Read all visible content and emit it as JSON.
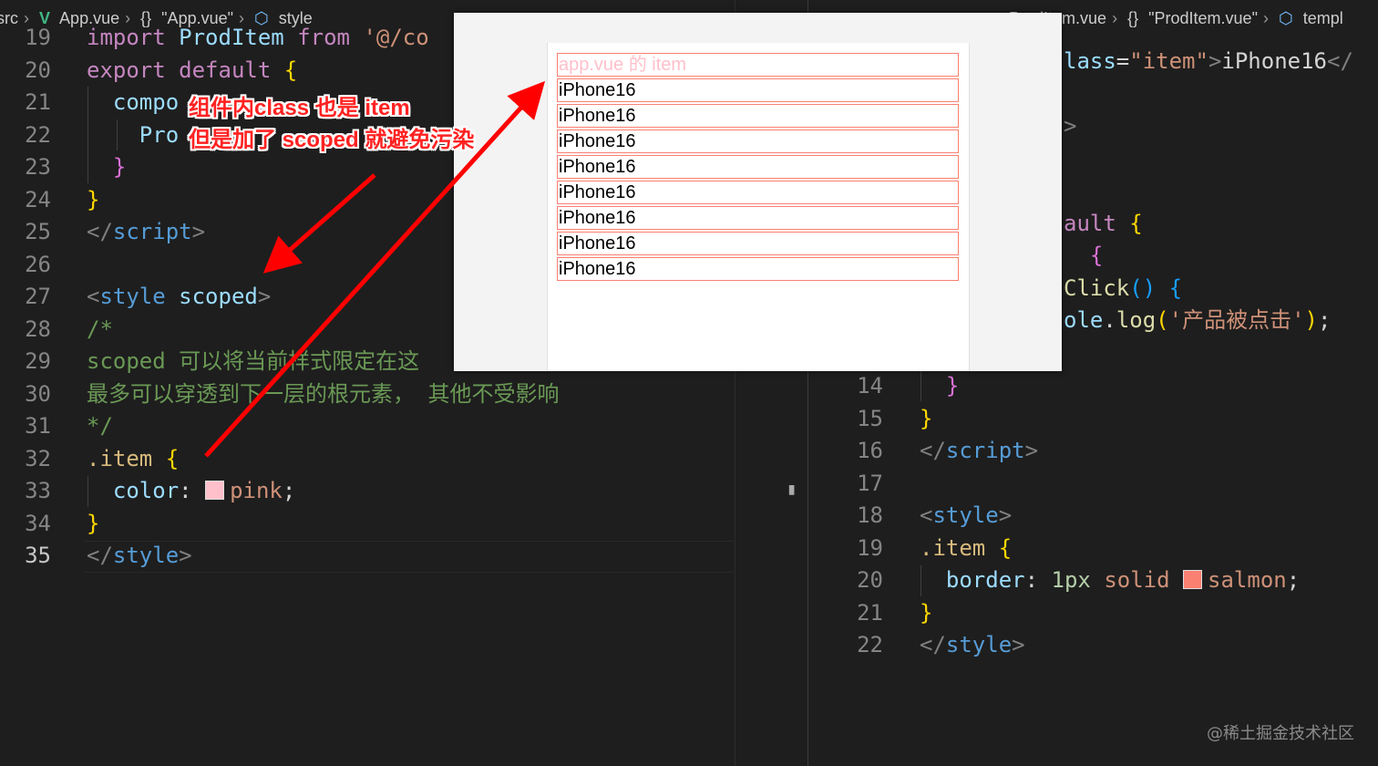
{
  "left_editor": {
    "breadcrumb": {
      "folder": "src",
      "file": "App.vue",
      "component": "\"App.vue\"",
      "section": "style"
    },
    "lines": [
      {
        "n": "19",
        "parts": [
          [
            "t-kw",
            "import"
          ],
          [
            "t-plain",
            " "
          ],
          [
            "t-id",
            "ProdItem"
          ],
          [
            "t-plain",
            " "
          ],
          [
            "t-kw",
            "from"
          ],
          [
            "t-plain",
            " "
          ],
          [
            "t-str",
            "'@/co"
          ]
        ]
      },
      {
        "n": "20",
        "parts": [
          [
            "t-kw",
            "export"
          ],
          [
            "t-plain",
            " "
          ],
          [
            "t-kw",
            "default"
          ],
          [
            "t-plain",
            " "
          ],
          [
            "t-gold",
            "{"
          ]
        ]
      },
      {
        "n": "21",
        "parts": [
          [
            "t-plain",
            "  "
          ],
          [
            "t-id",
            "compo"
          ]
        ]
      },
      {
        "n": "22",
        "parts": [
          [
            "t-plain",
            "    "
          ],
          [
            "t-id",
            "Pro"
          ]
        ]
      },
      {
        "n": "23",
        "parts": [
          [
            "t-plain",
            "  "
          ],
          [
            "t-pur",
            "}"
          ]
        ]
      },
      {
        "n": "24",
        "parts": [
          [
            "t-gold",
            "}"
          ]
        ]
      },
      {
        "n": "25",
        "parts": [
          [
            "t-br",
            "</"
          ],
          [
            "t-tag",
            "script"
          ],
          [
            "t-br",
            ">"
          ]
        ]
      },
      {
        "n": "26",
        "parts": []
      },
      {
        "n": "27",
        "parts": [
          [
            "t-br",
            "<"
          ],
          [
            "t-tag",
            "style"
          ],
          [
            "t-plain",
            " "
          ],
          [
            "t-id",
            "scoped"
          ],
          [
            "t-br",
            ">"
          ]
        ]
      },
      {
        "n": "28",
        "parts": [
          [
            "t-com",
            "/*"
          ]
        ]
      },
      {
        "n": "29",
        "parts": [
          [
            "t-com",
            "scoped 可以将当前样式限定在这"
          ]
        ]
      },
      {
        "n": "30",
        "parts": [
          [
            "t-com",
            "最多可以穿透到下一层的根元素， 其他不受影响"
          ]
        ]
      },
      {
        "n": "31",
        "parts": [
          [
            "t-com",
            "*/"
          ]
        ]
      },
      {
        "n": "32",
        "parts": [
          [
            "t-sel",
            ".item"
          ],
          [
            "t-plain",
            " "
          ],
          [
            "t-gold",
            "{"
          ]
        ]
      },
      {
        "n": "33",
        "parts": [
          [
            "t-plain",
            "  "
          ],
          [
            "t-prop",
            "color"
          ],
          [
            "t-plain",
            ": "
          ],
          [
            "swatch",
            "pink"
          ],
          [
            "t-val",
            "pink"
          ],
          [
            "t-plain",
            ";"
          ]
        ]
      },
      {
        "n": "34",
        "parts": [
          [
            "t-gold",
            "}"
          ]
        ]
      },
      {
        "n": "35",
        "parts": [
          [
            "t-br",
            "</"
          ],
          [
            "t-tag",
            "style"
          ],
          [
            "t-br",
            ">"
          ]
        ]
      }
    ]
  },
  "right_editor": {
    "breadcrumb": {
      "file": "ProdItem.vue",
      "component": "\"ProdItem.vue\"",
      "section": "templ"
    },
    "top_fragments": [
      {
        "parts": [
          [
            "t-id",
            "lass"
          ],
          [
            "t-plain",
            "="
          ],
          [
            "t-str",
            "\"item\""
          ],
          [
            "t-br",
            ">"
          ],
          [
            "t-plain",
            "iPhone16"
          ],
          [
            "t-br",
            "</"
          ]
        ]
      },
      {
        "parts": [
          [
            "t-br",
            ">"
          ]
        ]
      },
      {
        "parts": [
          [
            "t-kw",
            "ault"
          ],
          [
            "t-plain",
            " "
          ],
          [
            "t-gold",
            "{"
          ]
        ]
      },
      {
        "parts": [
          [
            "t-plain",
            "  "
          ],
          [
            "t-pur",
            "{"
          ]
        ]
      },
      {
        "parts": [
          [
            "t-fn",
            "Click"
          ],
          [
            "t-blu",
            "()"
          ],
          [
            "t-plain",
            " "
          ],
          [
            "t-blu",
            "{"
          ]
        ]
      },
      {
        "parts": [
          [
            "t-id",
            "ole"
          ],
          [
            "t-plain",
            "."
          ],
          [
            "t-fn",
            "log"
          ],
          [
            "t-gold",
            "("
          ],
          [
            "t-str",
            "'产品被点击'"
          ],
          [
            "t-gold",
            ")"
          ],
          [
            "t-plain",
            ";"
          ]
        ]
      }
    ],
    "lines": [
      {
        "n": "14",
        "parts": [
          [
            "t-plain",
            "  "
          ],
          [
            "t-pur",
            "}"
          ]
        ]
      },
      {
        "n": "15",
        "parts": [
          [
            "t-gold",
            "}"
          ]
        ]
      },
      {
        "n": "16",
        "parts": [
          [
            "t-br",
            "</"
          ],
          [
            "t-tag",
            "script"
          ],
          [
            "t-br",
            ">"
          ]
        ]
      },
      {
        "n": "17",
        "parts": []
      },
      {
        "n": "18",
        "parts": [
          [
            "t-br",
            "<"
          ],
          [
            "t-tag",
            "style"
          ],
          [
            "t-br",
            ">"
          ]
        ]
      },
      {
        "n": "19",
        "parts": [
          [
            "t-sel",
            ".item"
          ],
          [
            "t-plain",
            " "
          ],
          [
            "t-gold",
            "{"
          ]
        ]
      },
      {
        "n": "20",
        "parts": [
          [
            "t-plain",
            "  "
          ],
          [
            "t-prop",
            "border"
          ],
          [
            "t-plain",
            ": "
          ],
          [
            "t-num",
            "1px"
          ],
          [
            "t-plain",
            " "
          ],
          [
            "t-val",
            "solid"
          ],
          [
            "t-plain",
            " "
          ],
          [
            "swatch",
            "salmon"
          ],
          [
            "t-val",
            "salmon"
          ],
          [
            "t-plain",
            ";"
          ]
        ]
      },
      {
        "n": "21",
        "parts": [
          [
            "t-gold",
            "}"
          ]
        ]
      },
      {
        "n": "22",
        "parts": [
          [
            "t-br",
            "</"
          ],
          [
            "t-tag",
            "style"
          ],
          [
            "t-br",
            ">"
          ]
        ]
      }
    ]
  },
  "preview": {
    "items": [
      "app.vue 的 item",
      "iPhone16",
      "iPhone16",
      "iPhone16",
      "iPhone16",
      "iPhone16",
      "iPhone16",
      "iPhone16",
      "iPhone16"
    ]
  },
  "annotations": {
    "line1": "组件内class 也是 item",
    "line2": "但是加了 scoped 就避免污染"
  },
  "watermark": "@稀土掘金技术社区",
  "colors": {
    "annotation": "#ff2222",
    "preview_border": "salmon",
    "preview_pink": "pink"
  }
}
